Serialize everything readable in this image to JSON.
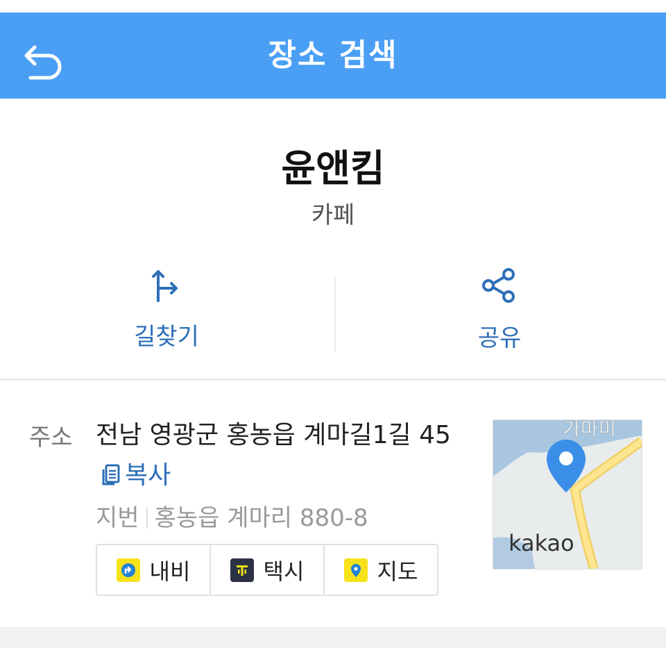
{
  "header": {
    "title": "장소 검색",
    "back_icon": "back-arrow-icon",
    "background": "#4a9ff5"
  },
  "place": {
    "name": "윤앤킴",
    "category": "카페"
  },
  "actions": [
    {
      "label": "길찾기",
      "icon": "directions-icon"
    },
    {
      "label": "공유",
      "icon": "share-icon"
    }
  ],
  "address": {
    "label": "주소",
    "road": "전남 영광군 홍농읍 계마길1길 45",
    "copy_label": "복사",
    "jibun_label": "지번",
    "jibun": "홍농읍 계마리 880-8"
  },
  "quick_buttons": [
    {
      "label": "내비",
      "icon": "navi-icon"
    },
    {
      "label": "택시",
      "icon": "taxi-icon"
    },
    {
      "label": "지도",
      "icon": "map-pin-icon"
    }
  ],
  "map": {
    "watermark": "kakao",
    "place_label": "가마미"
  },
  "colors": {
    "accent": "#2d6fb8",
    "badge_yellow": "#f7e21a"
  }
}
